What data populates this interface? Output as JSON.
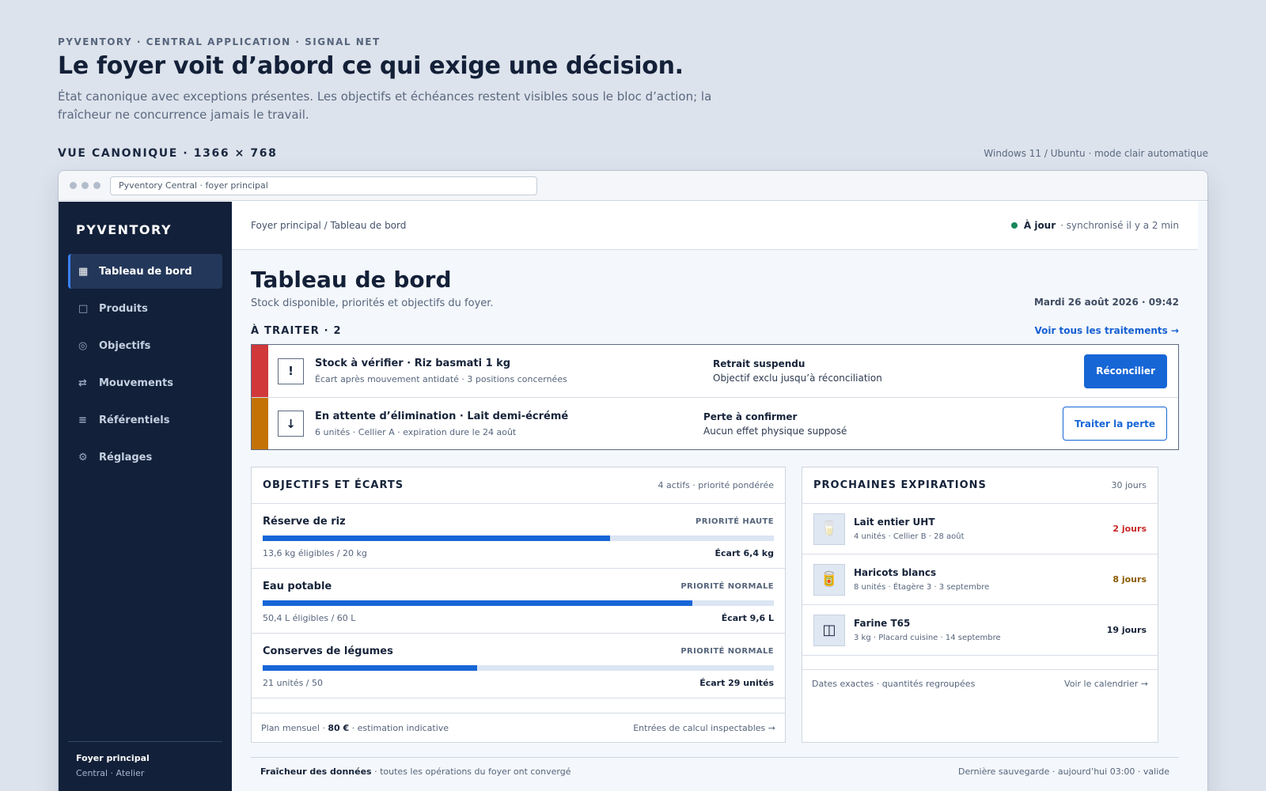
{
  "intro": {
    "eyebrow": "PYVENTORY · CENTRAL APPLICATION · SIGNAL NET",
    "headline": "Le foyer voit d’abord ce qui exige une décision.",
    "lede": "État canonique avec exceptions présentes. Les objectifs et échéances restent visibles sous le bloc d’action; la fraîcheur ne concurrence jamais le travail."
  },
  "view": {
    "label": "VUE CANONIQUE · 1366 × 768",
    "note": "Windows 11 / Ubuntu · mode clair automatique"
  },
  "window": {
    "url": "Pyventory Central · foyer principal"
  },
  "sidebar": {
    "brand": "PYVENTORY",
    "items": [
      {
        "label": "Tableau de bord",
        "icon": "▦"
      },
      {
        "label": "Produits",
        "icon": "□"
      },
      {
        "label": "Objectifs",
        "icon": "◎"
      },
      {
        "label": "Mouvements",
        "icon": "⇄"
      },
      {
        "label": "Référentiels",
        "icon": "≡"
      },
      {
        "label": "Réglages",
        "icon": "⚙"
      }
    ],
    "footer": {
      "household": "Foyer principal",
      "sites": "Central · Atelier"
    }
  },
  "topbar": {
    "breadcrumb": "Foyer principal / Tableau de bord",
    "status": "À jour",
    "sync": "· synchronisé il y a 2 min",
    "status_color": "#16875a"
  },
  "page": {
    "title": "Tableau de bord",
    "subtitle": "Stock disponible, priorités et objectifs du foyer.",
    "date": "Mardi 26 août 2026 · 09:42"
  },
  "todo": {
    "title": "À TRAITER · 2",
    "link": "Voir tous les traitements →",
    "items": [
      {
        "icon": "!",
        "title": "Stock à vérifier · Riz basmati 1 kg",
        "desc": "Écart après mouvement antidaté · 3 positions concernées",
        "effect_title": "Retrait suspendu",
        "effect_desc": "Objectif exclu jusqu’à réconciliation",
        "button": "Réconcilier",
        "color": "#d0383a"
      },
      {
        "icon": "↓",
        "title": "En attente d’élimination · Lait demi-écrémé",
        "desc": "6 unités · Cellier A · expiration dure le 24 août",
        "effect_title": "Perte à confirmer",
        "effect_desc": "Aucun effet physique supposé",
        "button": "Traiter la perte",
        "color": "#c47206"
      }
    ]
  },
  "goals": {
    "title": "OBJECTIFS ET ÉCARTS",
    "meta": "4 actifs · priorité pondérée",
    "items": [
      {
        "name": "Réserve de riz",
        "priority": "PRIORITÉ HAUTE",
        "progress": 0.68,
        "qty": "13,6 kg éligibles / 20 kg",
        "gap": "Écart 6,4 kg"
      },
      {
        "name": "Eau potable",
        "priority": "PRIORITÉ NORMALE",
        "progress": 0.84,
        "qty": "50,4 L éligibles / 60 L",
        "gap": "Écart 9,6 L"
      },
      {
        "name": "Conserves de légumes",
        "priority": "PRIORITÉ NORMALE",
        "progress": 0.42,
        "qty": "21 unités / 50",
        "gap": "Écart 29 unités"
      }
    ],
    "footer": {
      "prefix": "Plan mensuel ·",
      "amount": "80 €",
      "suffix": "· estimation indicative",
      "link": "Entrées de calcul inspectables →"
    }
  },
  "expirations": {
    "title": "PROCHAINES EXPIRATIONS",
    "meta": "30 jours",
    "items": [
      {
        "icon": "🥛",
        "name": "Lait entier UHT",
        "desc": "4 unités · Cellier B · 28 août",
        "days": "2 jours",
        "color": "#c62828"
      },
      {
        "icon": "🥫",
        "name": "Haricots blancs",
        "desc": "8 unités · Étagère 3 · 3 septembre",
        "days": "8 jours",
        "color": "#8a5a00"
      },
      {
        "icon": "◫",
        "name": "Farine T65",
        "desc": "3 kg · Placard cuisine · 14 septembre",
        "days": "19 jours",
        "color": "#16233a"
      }
    ],
    "footer": {
      "note": "Dates exactes · quantités regroupées",
      "link": "Voir le calendrier →"
    }
  },
  "freshness": {
    "label": "Fraîcheur des données",
    "text": "· toutes les opérations du foyer ont convergé",
    "save": "Dernière sauvegarde · aujourd’hui 03:00 · valide"
  }
}
